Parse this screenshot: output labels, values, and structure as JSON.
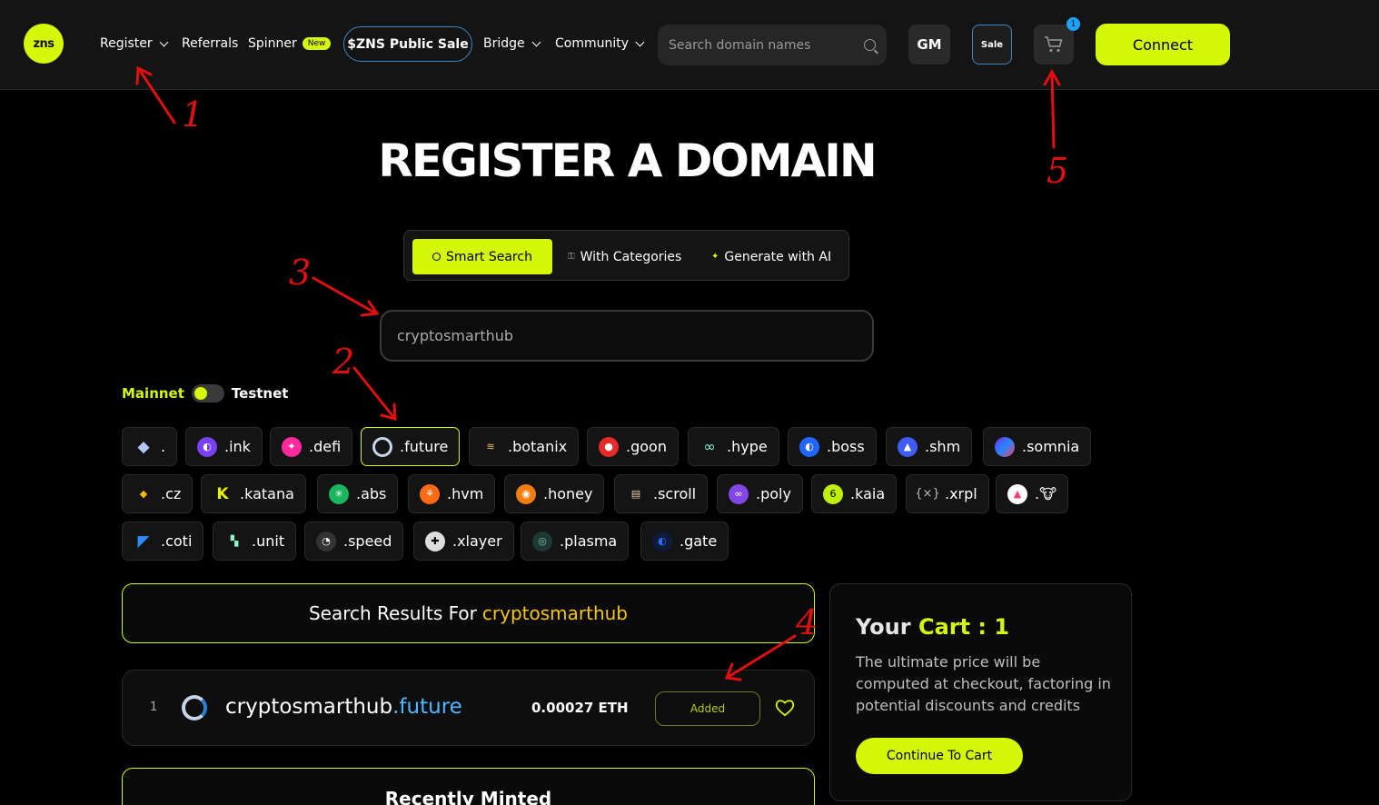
{
  "colors": {
    "accent": "#d4f70a",
    "background": "#000000",
    "blue": "#3a88c5",
    "annotation": "#e01010"
  },
  "nav": {
    "logo": "zns",
    "items": [
      {
        "label": "Register",
        "has_dropdown": true
      },
      {
        "label": "Referrals",
        "has_dropdown": false
      },
      {
        "label": "Spinner",
        "badge": "New"
      },
      {
        "label": "$ZNS Public Sale"
      },
      {
        "label": "Bridge",
        "has_dropdown": true
      },
      {
        "label": "Community",
        "has_dropdown": true
      }
    ],
    "search_placeholder": "Search domain names",
    "gm": "GM",
    "sale": "Sale",
    "cart_count": "1",
    "connect": "Connect"
  },
  "hero": {
    "title": "REGISTER A DOMAIN",
    "tabs": [
      {
        "label": "Smart Search",
        "icon": "search-icon",
        "active": true
      },
      {
        "label": "With Categories",
        "icon": "lock-icon"
      },
      {
        "label": "Generate with AI",
        "icon": "sparkle-icon"
      }
    ],
    "query": "cryptosmarthub"
  },
  "network": {
    "mainnet": "Mainnet",
    "testnet": "Testnet",
    "selected": "Mainnet"
  },
  "tlds": [
    ".",
    ".ink",
    ".defi",
    ".future",
    ".botanix",
    ".goon",
    ".hype",
    ".boss",
    ".shm",
    ".somnia",
    ".cz",
    ".katana",
    ".abs",
    ".hvm",
    ".honey",
    ".scroll",
    ".poly",
    ".kaia",
    ".xrpl",
    ".🐮",
    ".coti",
    ".unit",
    ".speed",
    ".xlayer",
    ".plasma",
    ".gate"
  ],
  "selected_tld": ".future",
  "results": {
    "heading_prefix": "Search Results For",
    "heading_query": "cryptosmarthub",
    "items": [
      {
        "index": "1",
        "name": "cryptosmarthub",
        "tld": ".future",
        "price": "0.00027 ETH",
        "status": "Added"
      }
    ],
    "recent_heading": "Recently Minted"
  },
  "cart": {
    "title_prefix": "Your",
    "title_accent": "Cart : 1",
    "description": "The ultimate price will be computed at checkout, factoring in potential discounts and credits",
    "button": "Continue To Cart"
  },
  "annotations": [
    "1",
    "2",
    "3",
    "4",
    "5"
  ]
}
